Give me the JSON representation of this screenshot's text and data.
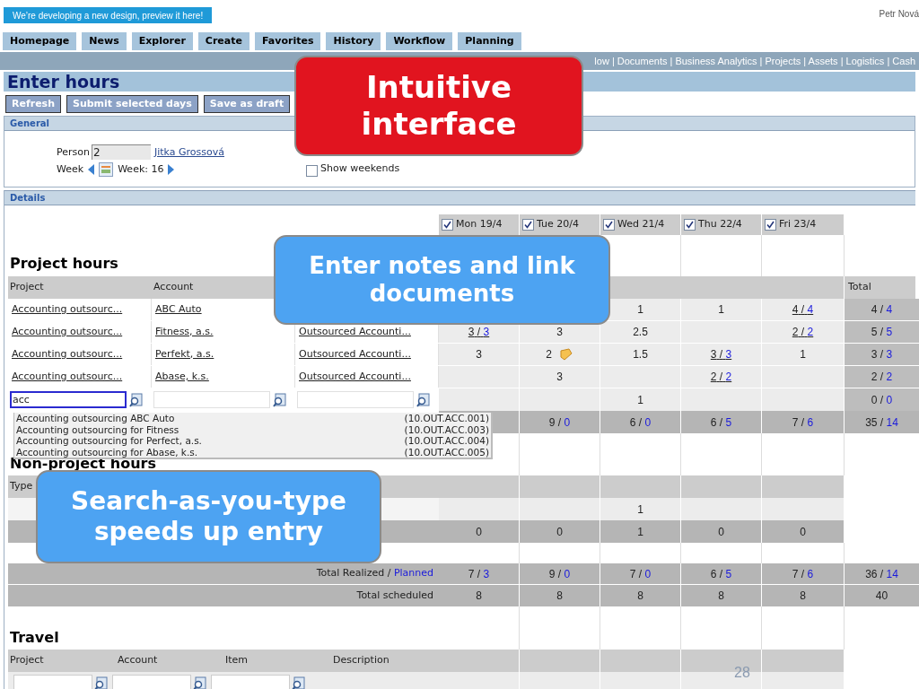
{
  "banner": "We’re developing a new design, preview it here!",
  "user": "Petr Nová",
  "tabs": [
    "Homepage",
    "News",
    "Explorer",
    "Create",
    "Favorites",
    "History",
    "Workflow",
    "Planning"
  ],
  "module_links": "low | Documents | Business Analytics | Projects | Assets | Logistics | Cash",
  "page_title": "Enter hours",
  "toolbar": [
    "Refresh",
    "Submit selected days",
    "Save as draft"
  ],
  "general": {
    "title": "General",
    "person_label": "Person",
    "person_id": "2",
    "person_name": "Jitka Grossová",
    "week_label": "Week",
    "week_value": "Week: 16",
    "show_weekends": {
      "label": "Show weekends",
      "checked": false
    }
  },
  "details": {
    "title": "Details",
    "days": [
      {
        "label": "Mon 19/4",
        "checked": true
      },
      {
        "label": "Tue 20/4",
        "checked": true
      },
      {
        "label": "Wed 21/4",
        "checked": true
      },
      {
        "label": "Thu 22/4",
        "checked": true
      },
      {
        "label": "Fri 23/4",
        "checked": true
      }
    ],
    "project_hours": {
      "title": "Project hours",
      "columns": [
        "Project",
        "Account"
      ],
      "total_label": "Total",
      "rows": [
        {
          "project": "Accounting outsourc...",
          "account": "ABC Auto",
          "activity": null,
          "cells": [
            null,
            null,
            {
              "v": "1"
            },
            {
              "v": "1"
            },
            {
              "pair": [
                "4",
                "/",
                "4"
              ],
              "link": true
            }
          ],
          "total": {
            "pair": [
              "4",
              "/",
              "4"
            ]
          }
        },
        {
          "project": "Accounting outsourc...",
          "account": "Fitness, a.s.",
          "activity": "Outsourced Accounti...",
          "cells": [
            {
              "pair": [
                "3",
                "/",
                "3"
              ],
              "link": true
            },
            {
              "v": "3"
            },
            {
              "v": "2.5"
            },
            null,
            {
              "pair": [
                "2",
                "/",
                "2"
              ],
              "link": true
            }
          ],
          "total": {
            "pair": [
              "5",
              "/",
              "5"
            ]
          }
        },
        {
          "project": "Accounting outsourc...",
          "account": "Perfekt, a.s.",
          "activity": "Outsourced Accounti...",
          "cells": [
            {
              "v": "3"
            },
            {
              "v": "2",
              "note": true
            },
            {
              "v": "1.5"
            },
            {
              "pair": [
                "3",
                "/",
                "3"
              ],
              "link": true
            },
            {
              "v": "1"
            }
          ],
          "total": {
            "pair": [
              "3",
              "/",
              "3"
            ]
          }
        },
        {
          "project": "Accounting outsourc...",
          "account": "Abase, k.s.",
          "activity": "Outsourced Accounti...",
          "cells": [
            null,
            {
              "v": "3"
            },
            null,
            {
              "pair": [
                "2",
                "/",
                "2"
              ],
              "link": true
            },
            null
          ],
          "total": {
            "pair": [
              "2",
              "/",
              "2"
            ]
          }
        }
      ],
      "entry": {
        "project": "acc",
        "cells": [
          null,
          null,
          {
            "v": "1"
          },
          null,
          null
        ],
        "total": {
          "pair": [
            "0",
            "/",
            "0"
          ]
        }
      },
      "sums": [
        {
          "pair": [
            "9",
            "/",
            "0"
          ]
        },
        {
          "pair": [
            "6",
            "/",
            "0"
          ]
        },
        {
          "pair": [
            "6",
            "/",
            "5"
          ]
        },
        {
          "pair": [
            "7",
            "/",
            "6"
          ]
        },
        {
          "pair": [
            "35",
            "/",
            "14"
          ]
        }
      ],
      "suggestions": [
        {
          "name": "Accounting outsourcing ABC Auto",
          "code": "(10.OUT.ACC.001)"
        },
        {
          "name": "Accounting outsourcing for Fitness",
          "code": "(10.OUT.ACC.003)"
        },
        {
          "name": "Accounting outsourcing for Perfect, a.s.",
          "code": "(10.OUT.ACC.004)"
        },
        {
          "name": "Accounting outsourcing for Abase, k.s.",
          "code": "(10.OUT.ACC.005)"
        }
      ]
    },
    "non_project_hours": {
      "title": "Non-project hours",
      "columns": [
        "Type"
      ],
      "cells": [
        null,
        null,
        {
          "v": "1"
        },
        null,
        null
      ],
      "sums": [
        {
          "v": "0"
        },
        {
          "v": "0"
        },
        {
          "v": "1"
        },
        {
          "v": "0"
        },
        {
          "v": "0"
        }
      ]
    },
    "total_realized": {
      "label": [
        "Total Realized",
        "/",
        "Planned"
      ],
      "cells": [
        {
          "pair": [
            "7",
            "/",
            "3"
          ]
        },
        {
          "pair": [
            "9",
            "/",
            "0"
          ]
        },
        {
          "pair": [
            "7",
            "/",
            "0"
          ]
        },
        {
          "pair": [
            "6",
            "/",
            "5"
          ]
        },
        {
          "pair": [
            "7",
            "/",
            "6"
          ]
        },
        {
          "pair": [
            "36",
            "/",
            "14"
          ]
        }
      ]
    },
    "total_scheduled": {
      "label": "Total scheduled",
      "cells": [
        {
          "v": "8"
        },
        {
          "v": "8"
        },
        {
          "v": "8"
        },
        {
          "v": "8"
        },
        {
          "v": "8"
        },
        {
          "v": "40"
        }
      ]
    },
    "travel": {
      "title": "Travel",
      "columns": [
        "Project",
        "Account",
        "Item",
        "Description"
      ]
    }
  },
  "callouts": [
    {
      "text": "Intuitive interface",
      "color": "#e1141f"
    },
    {
      "text": "Enter notes and link documents",
      "color": "#4da3f2"
    },
    {
      "text": "Search-as-you-type speeds up entry",
      "color": "#4da3f2"
    }
  ],
  "page_number": "28"
}
